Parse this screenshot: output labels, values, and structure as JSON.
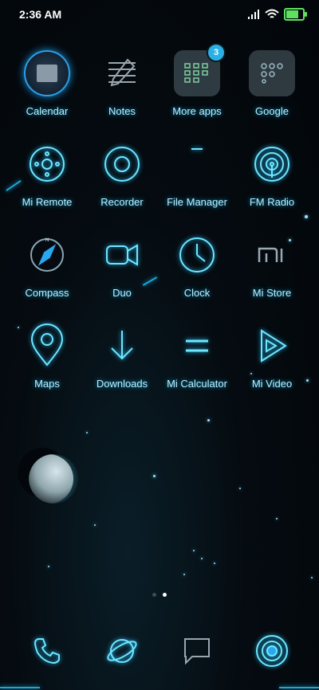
{
  "status_bar": {
    "time": "2:36 AM"
  },
  "apps": [
    {
      "label": "Calendar",
      "icon": "calendar-icon"
    },
    {
      "label": "Notes",
      "icon": "notes-icon"
    },
    {
      "label": "More apps",
      "icon": "folder-icon",
      "badge": "3"
    },
    {
      "label": "Google",
      "icon": "folder-icon"
    },
    {
      "label": "Mi Remote",
      "icon": "remote-icon"
    },
    {
      "label": "Recorder",
      "icon": "recorder-icon"
    },
    {
      "label": "File Manager",
      "icon": "file-manager-icon"
    },
    {
      "label": "FM Radio",
      "icon": "radio-icon"
    },
    {
      "label": "Compass",
      "icon": "compass-icon"
    },
    {
      "label": "Duo",
      "icon": "video-camera-icon"
    },
    {
      "label": "Clock",
      "icon": "clock-icon"
    },
    {
      "label": "Mi Store",
      "icon": "mi-store-icon"
    },
    {
      "label": "Maps",
      "icon": "map-pin-icon"
    },
    {
      "label": "Downloads",
      "icon": "download-icon"
    },
    {
      "label": "Mi Calculator",
      "icon": "calculator-icon"
    },
    {
      "label": "Mi Video",
      "icon": "play-icon"
    }
  ],
  "dock": [
    {
      "icon": "phone-icon"
    },
    {
      "icon": "browser-planet-icon"
    },
    {
      "icon": "messages-icon"
    },
    {
      "icon": "camera-icon"
    }
  ],
  "pagination": {
    "active_page": 2,
    "page_count": 2
  },
  "theme": {
    "accent": "#6fe6ff",
    "badge": "#2bb0e6"
  }
}
